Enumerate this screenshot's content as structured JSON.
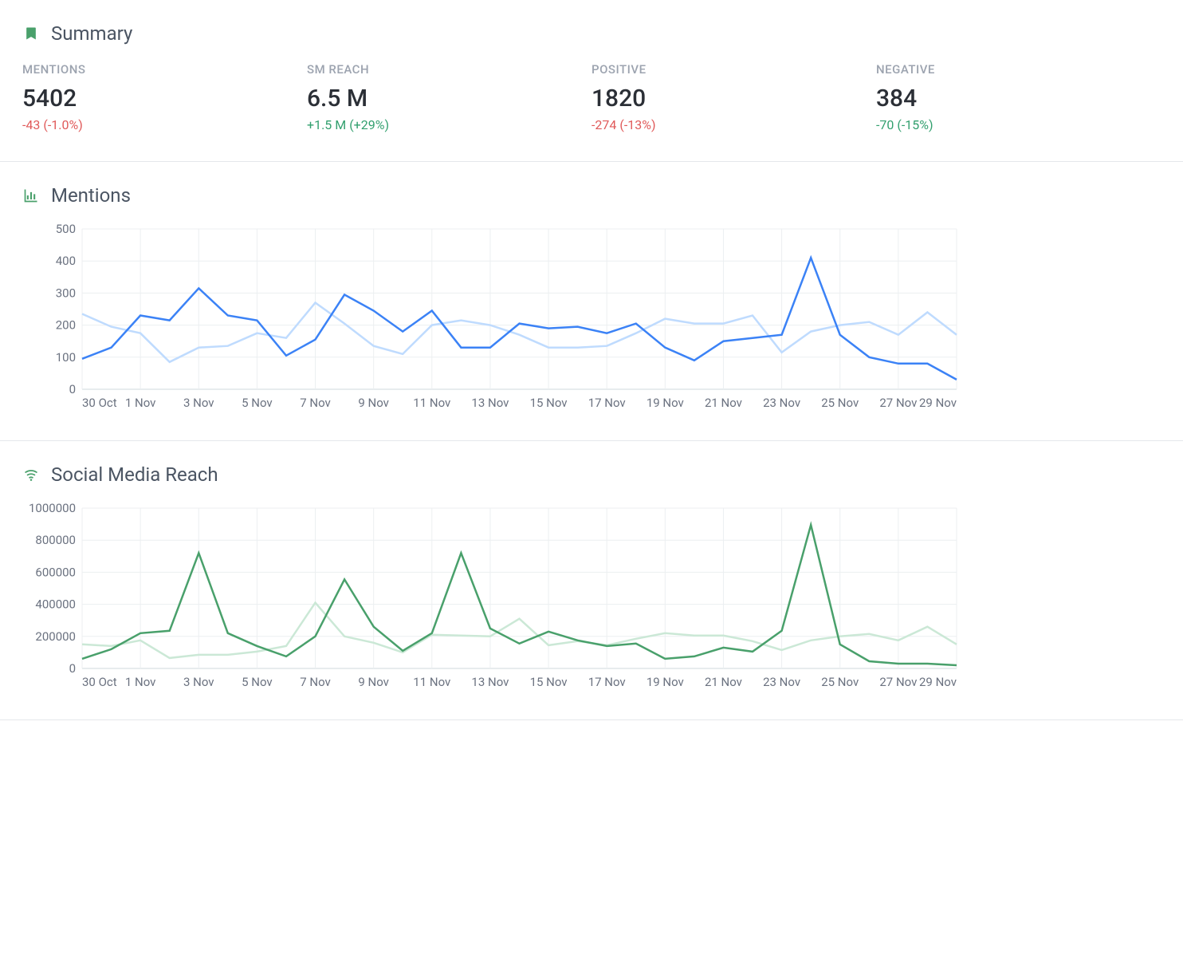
{
  "summary": {
    "title": "Summary",
    "metrics": [
      {
        "label": "MENTIONS",
        "value": "5402",
        "delta": "-43  (-1.0%)",
        "delta_dir": "neg"
      },
      {
        "label": "SM REACH",
        "value": "6.5 M",
        "delta": "+1.5 M  (+29%)",
        "delta_dir": "pos"
      },
      {
        "label": "POSITIVE",
        "value": "1820",
        "delta": "-274  (-13%)",
        "delta_dir": "neg"
      },
      {
        "label": "NEGATIVE",
        "value": "384",
        "delta": "-70  (-15%)",
        "delta_dir": "pos"
      }
    ]
  },
  "mentions_section": {
    "title": "Mentions"
  },
  "reach_section": {
    "title": "Social Media Reach"
  },
  "chart_data": [
    {
      "id": "mentions",
      "type": "line",
      "title": "Mentions",
      "xlabel": "",
      "ylabel": "",
      "ylim": [
        0,
        500
      ],
      "yticks": [
        0,
        100,
        200,
        300,
        400,
        500
      ],
      "categories": [
        "30 Oct",
        "31 Oct",
        "1 Nov",
        "2 Nov",
        "3 Nov",
        "4 Nov",
        "5 Nov",
        "6 Nov",
        "7 Nov",
        "8 Nov",
        "9 Nov",
        "10 Nov",
        "11 Nov",
        "12 Nov",
        "13 Nov",
        "14 Nov",
        "15 Nov",
        "16 Nov",
        "17 Nov",
        "18 Nov",
        "19 Nov",
        "20 Nov",
        "21 Nov",
        "22 Nov",
        "23 Nov",
        "24 Nov",
        "25 Nov",
        "26 Nov",
        "27 Nov",
        "28 Nov",
        "29 Nov"
      ],
      "xtick_labels": [
        "30 Oct",
        "1 Nov",
        "3 Nov",
        "5 Nov",
        "7 Nov",
        "9 Nov",
        "11 Nov",
        "13 Nov",
        "15 Nov",
        "17 Nov",
        "19 Nov",
        "21 Nov",
        "23 Nov",
        "25 Nov",
        "27 Nov",
        "29 Nov"
      ],
      "series": [
        {
          "name": "current",
          "color": "#3b82f6",
          "values": [
            95,
            130,
            230,
            215,
            315,
            230,
            215,
            105,
            155,
            295,
            245,
            180,
            245,
            130,
            130,
            205,
            190,
            195,
            175,
            205,
            130,
            90,
            150,
            160,
            170,
            410,
            170,
            100,
            80,
            80,
            30
          ]
        },
        {
          "name": "previous",
          "color": "#bfdbfe",
          "values": [
            235,
            195,
            175,
            85,
            130,
            135,
            175,
            160,
            270,
            205,
            135,
            110,
            200,
            215,
            200,
            170,
            130,
            130,
            135,
            175,
            220,
            205,
            205,
            230,
            115,
            180,
            200,
            210,
            170,
            240,
            170
          ]
        }
      ]
    },
    {
      "id": "reach",
      "type": "line",
      "title": "Social Media Reach",
      "xlabel": "",
      "ylabel": "",
      "ylim": [
        0,
        1000000
      ],
      "yticks": [
        0,
        200000,
        400000,
        600000,
        800000,
        1000000
      ],
      "categories": [
        "30 Oct",
        "31 Oct",
        "1 Nov",
        "2 Nov",
        "3 Nov",
        "4 Nov",
        "5 Nov",
        "6 Nov",
        "7 Nov",
        "8 Nov",
        "9 Nov",
        "10 Nov",
        "11 Nov",
        "12 Nov",
        "13 Nov",
        "14 Nov",
        "15 Nov",
        "16 Nov",
        "17 Nov",
        "18 Nov",
        "19 Nov",
        "20 Nov",
        "21 Nov",
        "22 Nov",
        "23 Nov",
        "24 Nov",
        "25 Nov",
        "26 Nov",
        "27 Nov",
        "28 Nov",
        "29 Nov"
      ],
      "xtick_labels": [
        "30 Oct",
        "1 Nov",
        "3 Nov",
        "5 Nov",
        "7 Nov",
        "9 Nov",
        "11 Nov",
        "13 Nov",
        "15 Nov",
        "17 Nov",
        "19 Nov",
        "21 Nov",
        "23 Nov",
        "25 Nov",
        "27 Nov",
        "29 Nov"
      ],
      "series": [
        {
          "name": "current",
          "color": "#49a06b",
          "values": [
            60000,
            120000,
            220000,
            235000,
            720000,
            220000,
            140000,
            75000,
            200000,
            555000,
            260000,
            110000,
            220000,
            720000,
            250000,
            155000,
            230000,
            175000,
            140000,
            155000,
            60000,
            75000,
            130000,
            105000,
            235000,
            895000,
            150000,
            45000,
            30000,
            30000,
            20000
          ]
        },
        {
          "name": "previous",
          "color": "#cbe8d6",
          "values": [
            150000,
            140000,
            175000,
            65000,
            85000,
            85000,
            105000,
            140000,
            410000,
            200000,
            160000,
            100000,
            210000,
            205000,
            200000,
            310000,
            145000,
            170000,
            145000,
            185000,
            220000,
            205000,
            205000,
            170000,
            115000,
            175000,
            200000,
            215000,
            175000,
            260000,
            150000
          ]
        }
      ]
    }
  ]
}
